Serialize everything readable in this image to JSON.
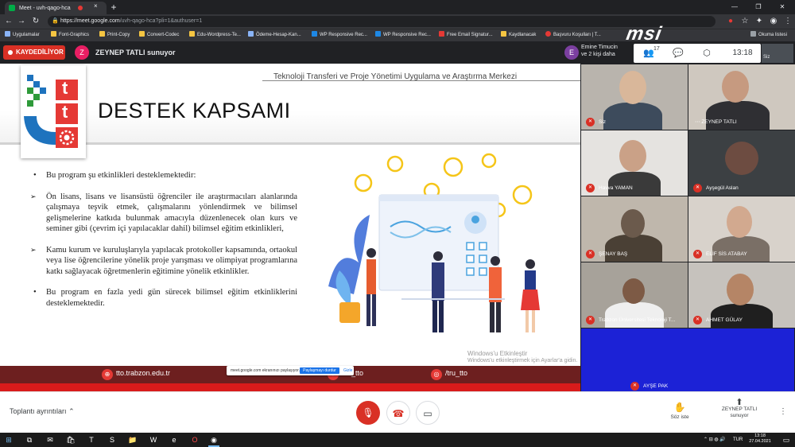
{
  "browser": {
    "tab_title": "Meet - uvh-qago-hca",
    "tab_close": "×",
    "new_tab": "+",
    "window_minimize": "—",
    "window_maximize": "❐",
    "window_close": "✕",
    "url_host": "https://meet.google.com",
    "url_path": "/uvh-qago-hca?pli=1&authuser=1",
    "bookmarks": [
      "Uygulamalar",
      "Font-Graphics",
      "Print-Copy",
      "Convert-Codec",
      "Edu-Wordpress-Te...",
      "Ödeme-Hesap-Kan...",
      "WP Responsive Rec...",
      "WP Responsive Rec...",
      "Free Email Signatur...",
      "Kaydlanacak",
      "Başvuru Koşulları | T..."
    ],
    "reading_list": "Okuma listesi",
    "brand_overlay": "msi"
  },
  "meet_top": {
    "record_label": "KAYDEDİLİYOR",
    "presenter_initial": "Z",
    "presenter_text": "ZEYNEP TATLI sunuyor",
    "people_initial": "E",
    "people_line1": "Emine Timucin",
    "people_line2": "ve 2 kişi daha",
    "participant_count": "17",
    "time": "13:18",
    "self_label": "Siz"
  },
  "slide": {
    "header_sub": "Teknoloji Transferi ve Proje Yönetimi  Uygulama ve Araştırma Merkezi",
    "logo_letter_1": "t",
    "logo_letter_2": "t",
    "title": "DESTEK KAPSAMI",
    "bullets": [
      "Bu program şu etkinlikleri desteklemektedir:",
      "Ön lisans, lisans ve lisansüstü öğrenciler ile araştırmacıları alanlarında çalışmaya teşvik etmek, çalışmalarını yönlendirmek ve bilimsel gelişmelerine katkıda bulunmak amacıyla düzenlenecek olan kurs ve seminer gibi (çevrim içi yapılacaklar dahil) bilimsel eğitim etkinlikleri,",
      "Kamu kurum ve kuruluşlarıyla yapılacak protokoller kapsamında, ortaokul veya lise öğrencilerine yönelik proje yarışması ve olimpiyat programlarına katkı sağlayacak öğretmenlerin eğitimine yönelik etkinlikler.",
      "Bu program en fazla yedi gün sürecek bilimsel eğitim etkinliklerini desteklemektedir."
    ],
    "footer_items": [
      "tto.trabzon.edu.tr",
      "ktu_tto",
      "/tru_tto"
    ],
    "share_popup_text": "meet.google.com ekranınızı paylaşıyor.",
    "share_popup_button": "Paylaşmayı durdur",
    "share_popup_hide": "Gizle",
    "watermark_line1": "Windows'u Etkinleştir",
    "watermark_line2": "Windows'u etkinleştirmek için Ayarlar'a gidin."
  },
  "participants": [
    {
      "name": "Siz",
      "muted": true
    },
    {
      "name": "ZEYNEP TATLI",
      "muted": false
    },
    {
      "name": "Havva YAMAN",
      "muted": true
    },
    {
      "name": "Ayşegül Aslan",
      "muted": true
    },
    {
      "name": "ŞENAY BAŞ",
      "muted": true
    },
    {
      "name": "ELİF SİS ATABAY",
      "muted": true
    },
    {
      "name": "Trabzon Üniversitesi Teknoloji T...",
      "muted": true
    },
    {
      "name": "AHMET GÜLAY",
      "muted": true
    },
    {
      "name": "AYŞE PAK",
      "muted": true
    }
  ],
  "controls": {
    "details_label": "Toplantı ayrıntıları",
    "raise_hand": "Söz iste",
    "presenter_line1": "ZEYNEP TATLI",
    "presenter_line2": "sunuyor"
  },
  "taskbar": {
    "lang": "TUR",
    "time": "13:18",
    "date": "27.04.2021"
  }
}
